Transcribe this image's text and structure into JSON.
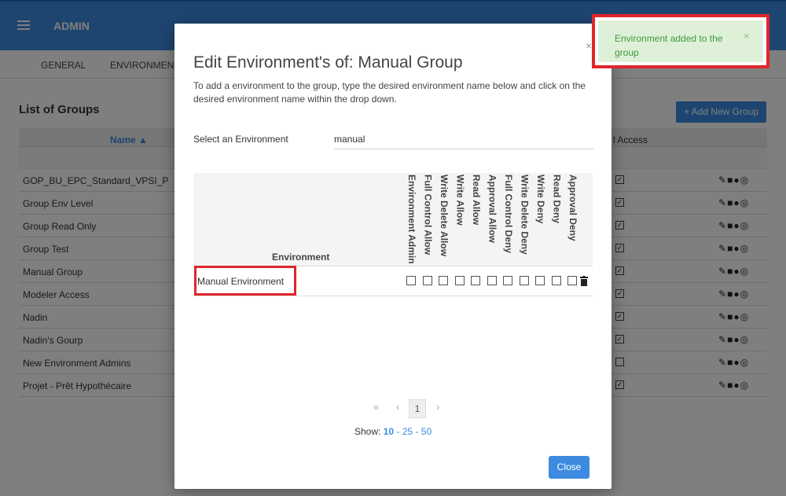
{
  "app": {
    "brand": "ADMIN",
    "nav_tabs": [
      "GENERAL",
      "ENVIRONMEN"
    ]
  },
  "groups": {
    "title": "List of Groups",
    "add_button": "+ Add New Group",
    "col_name": "Name ▲",
    "col_access": "l Access",
    "rows": [
      {
        "name": "GOP_BU_EPC_Standard_VPSI_P",
        "checked": true
      },
      {
        "name": "Group Env Level",
        "checked": true
      },
      {
        "name": "Group Read Only",
        "checked": true
      },
      {
        "name": "Group Test",
        "checked": true
      },
      {
        "name": "Manual Group",
        "checked": true
      },
      {
        "name": "Modeler Access",
        "checked": true
      },
      {
        "name": "Nadin",
        "checked": true
      },
      {
        "name": "Nadin's Gourp",
        "checked": true
      },
      {
        "name": "New Environment Admins",
        "checked": false
      },
      {
        "name": "Projet - Prêt Hypothécaire",
        "checked": true
      }
    ],
    "row_actions_icons": [
      "pencil-icon",
      "trash-icon",
      "user-icon",
      "globe-icon"
    ]
  },
  "modal": {
    "close_x": "×",
    "title": "Edit Environment's of: Manual Group",
    "description": "To add a environment to the group, type the desired environment name below and click on the desired environment name within the drop down.",
    "select_label": "Select an Environment",
    "select_value": "manual",
    "col_environment": "Environment",
    "permission_columns": [
      "Environment Admin",
      "Full Control Allow",
      "Write Delete Allow",
      "Write Allow",
      "Read Allow",
      "Approval Allow",
      "Full Control Deny",
      "Write Delete Deny",
      "Write Deny",
      "Read Deny",
      "Approval Deny"
    ],
    "rows": [
      {
        "name": "Manual Environment",
        "permissions": [
          false,
          false,
          false,
          false,
          false,
          false,
          false,
          false,
          false,
          false,
          false
        ]
      }
    ],
    "pager": {
      "first": "«",
      "prev": "‹",
      "current": "1",
      "next": "›"
    },
    "show_label": "Show:",
    "show_options": [
      "10",
      "25",
      "50"
    ],
    "show_sep": "-",
    "close_button": "Close"
  },
  "toast": {
    "message": "Environment added to the group",
    "close": "×",
    "color": "#dff0d8"
  }
}
